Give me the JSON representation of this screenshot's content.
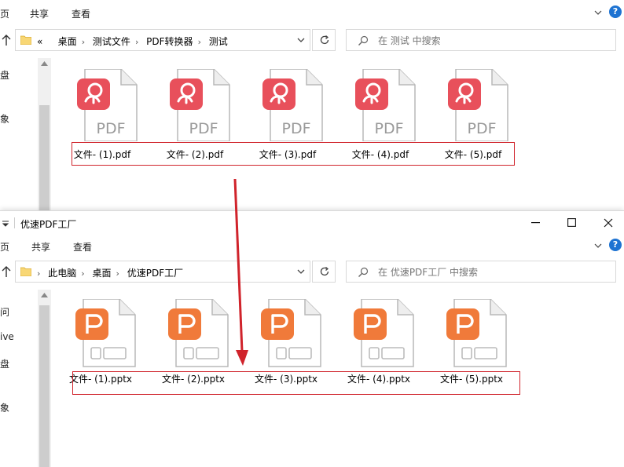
{
  "window_top": {
    "ribbon": {
      "tabs": [
        "页",
        "共享",
        "查看"
      ]
    },
    "address": {
      "crumbs": [
        "«",
        "桌面",
        "测试文件",
        "PDF转换器",
        "测试"
      ]
    },
    "search": {
      "placeholder": "在 测试 中搜索"
    },
    "sidebar": {
      "items": [
        "盘",
        "象"
      ]
    },
    "files": [
      {
        "name": "文件- (1).pdf",
        "icon": "pdf-file-icon"
      },
      {
        "name": "文件- (2).pdf",
        "icon": "pdf-file-icon"
      },
      {
        "name": "文件- (3).pdf",
        "icon": "pdf-file-icon"
      },
      {
        "name": "文件- (4).pdf",
        "icon": "pdf-file-icon"
      },
      {
        "name": "文件- (5).pdf",
        "icon": "pdf-file-icon"
      }
    ],
    "pdf_badge_text": "PDF"
  },
  "window_bottom": {
    "title": "优速PDF工厂",
    "ribbon": {
      "tabs": [
        "页",
        "共享",
        "查看"
      ]
    },
    "address": {
      "crumbs": [
        "此电脑",
        "桌面",
        "优速PDF工厂"
      ]
    },
    "search": {
      "placeholder": "在 优速PDF工厂 中搜索"
    },
    "sidebar": {
      "items": [
        "问",
        "ive",
        "盘",
        "象"
      ]
    },
    "files": [
      {
        "name": "文件- (1).pptx",
        "icon": "pptx-file-icon"
      },
      {
        "name": "文件- (2).pptx",
        "icon": "pptx-file-icon"
      },
      {
        "name": "文件- (3).pptx",
        "icon": "pptx-file-icon"
      },
      {
        "name": "文件- (4).pptx",
        "icon": "pptx-file-icon"
      },
      {
        "name": "文件- (5).pptx",
        "icon": "pptx-file-icon"
      }
    ]
  },
  "colors": {
    "pdf_red": "#e8505b",
    "ppt_orange": "#f07a3a",
    "highlight_red": "#d0232b",
    "folder_yellow": "#f8d775",
    "help_blue": "#1e73d2"
  }
}
